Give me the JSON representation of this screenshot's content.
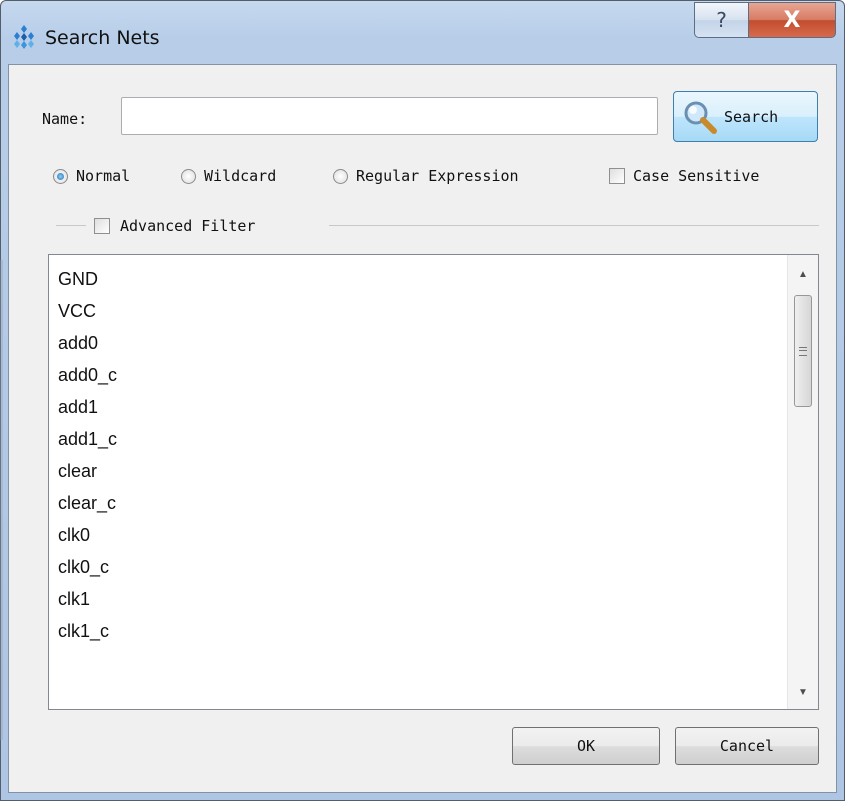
{
  "window": {
    "title": "Search Nets",
    "help_glyph": "?",
    "close_glyph": "X"
  },
  "search": {
    "name_label": "Name:",
    "name_value": "",
    "name_placeholder": "",
    "search_button_label": "Search"
  },
  "match_modes": [
    {
      "label": "Normal",
      "checked": true
    },
    {
      "label": "Wildcard",
      "checked": false
    },
    {
      "label": "Regular Expression",
      "checked": false
    }
  ],
  "case_sensitive": {
    "label": "Case Sensitive",
    "checked": false
  },
  "advanced_filter": {
    "label": "Advanced Filter",
    "checked": false
  },
  "nets": [
    "GND",
    "VCC",
    "add0",
    "add0_c",
    "add1",
    "add1_c",
    "clear",
    "clear_c",
    "clk0",
    "clk0_c",
    "clk1",
    "clk1_c"
  ],
  "scrollbar": {
    "up_glyph": "▲",
    "down_glyph": "▼"
  },
  "buttons": {
    "ok_label": "OK",
    "cancel_label": "Cancel"
  },
  "colors": {
    "title_bar": "#b7cde8",
    "close_button": "#c24d2e",
    "dialog_background": "#f0f0f0",
    "radio_selected": "#1f6eb8",
    "search_button": "#bee6fd"
  }
}
